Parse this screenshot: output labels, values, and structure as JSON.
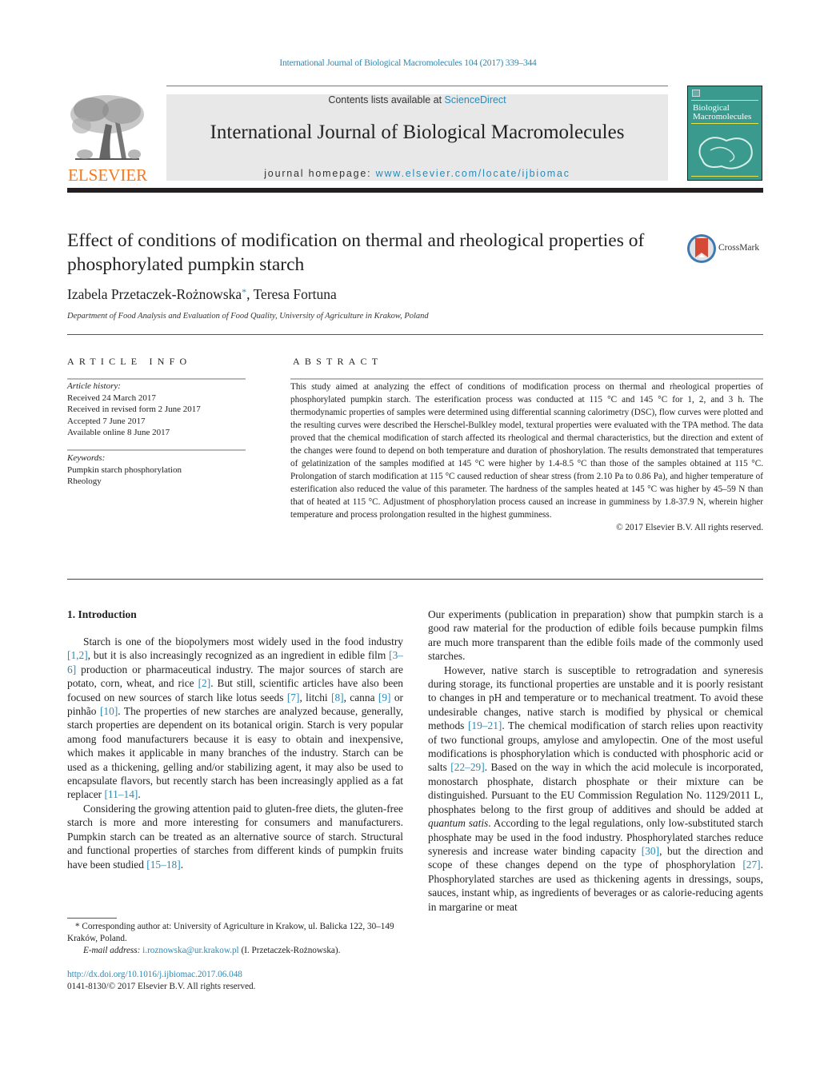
{
  "header": {
    "citation": "International Journal of Biological Macromolecules 104 (2017) 339–344",
    "publisher_logo": "ELSEVIER",
    "contents_prefix": "Contents lists available at ",
    "contents_link": "ScienceDirect",
    "journal_title": "International Journal of Biological Macromolecules",
    "homepage_prefix": "journal homepage: ",
    "homepage_link": "www.elsevier.com/locate/ijbiomac",
    "cover_title_line1": "Biological",
    "cover_title_line2": "Macromolecules",
    "crossmark_label": "CrossMark"
  },
  "article": {
    "title": "Effect of conditions of modification on thermal and rheological properties of phosphorylated pumpkin starch",
    "author1": "Izabela Przetaczek-Rożnowska",
    "author1_mark": "*",
    "author_sep": ", ",
    "author2": "Teresa Fortuna",
    "affiliation": "Department of Food Analysis and Evaluation of Food Quality, University of Agriculture in Krakow, Poland"
  },
  "article_info": {
    "heading": "ARTICLE INFO",
    "history_label": "Article history:",
    "history": [
      "Received 24 March 2017",
      "Received in revised form 2 June 2017",
      "Accepted 7 June 2017",
      "Available online 8 June 2017"
    ],
    "keywords_label": "Keywords:",
    "keywords": [
      "Pumpkin starch phosphorylation",
      "Rheology"
    ]
  },
  "abstract": {
    "heading": "ABSTRACT",
    "text": "This study aimed at analyzing the effect of conditions of modification process on thermal and rheological properties of phosphorylated pumpkin starch. The esterification process was conducted at 115 °C and 145 °C for 1, 2, and 3 h. The thermodynamic properties of samples were determined using differential scanning calorimetry (DSC), flow curves were plotted and the resulting curves were described the Herschel-Bulkley model, textural properties were evaluated with the TPA method. The data proved that the chemical modification of starch affected its rheological and thermal characteristics, but the direction and extent of the changes were found to depend on both temperature and duration of phoshorylation. The results demonstrated that temperatures of gelatinization of the samples modified at 145 °C were higher by 1.4-8.5 °C than those of the samples obtained at 115 °C. Prolongation of starch modification at 115 °C caused reduction of shear stress (from 2.10 Pa to 0.86 Pa), and higher temperature of esterification also reduced the value of this parameter. The hardness of the samples heated at 145 °C was higher by 45–59 N than that of heated at 115 °C. Adjustment of phosphorylation process caused an increase in gumminess by 1.8-37.9 N, wherein higher temperature and process prolongation resulted in the highest gumminess.",
    "copyright": "© 2017 Elsevier B.V. All rights reserved."
  },
  "intro": {
    "heading": "1.  Introduction",
    "p1": [
      {
        "t": "Starch is one of the biopolymers most widely used in the food industry "
      },
      {
        "ref": "[1,2]"
      },
      {
        "t": ", but it is also increasingly recognized as an ingredient in edible film "
      },
      {
        "ref": "[3–6]"
      },
      {
        "t": " production or pharmaceutical industry. The major sources of starch are potato, corn, wheat, and rice "
      },
      {
        "ref": "[2]"
      },
      {
        "t": ". But still, scientific articles have also been focused on new sources of starch like lotus seeds "
      },
      {
        "ref": "[7]"
      },
      {
        "t": ", litchi "
      },
      {
        "ref": "[8]"
      },
      {
        "t": ", canna "
      },
      {
        "ref": "[9]"
      },
      {
        "t": " or pinhão "
      },
      {
        "ref": "[10]"
      },
      {
        "t": ". The properties of new starches are analyzed because, generally, starch properties are dependent on its botanical origin. Starch is very popular among food manufacturers because it is easy to obtain and inexpensive, which makes it applicable in many branches of the industry. Starch can be used as a thickening, gelling and/or stabilizing agent, it may also be used to encapsulate flavors, but recently starch has been increasingly applied as a fat replacer "
      },
      {
        "ref": "[11–14]"
      },
      {
        "t": "."
      }
    ],
    "p2": [
      {
        "t": "Considering the growing attention paid to gluten-free diets, the gluten-free starch is more and more interesting for consumers and manufacturers. Pumpkin starch can be treated as an alternative source of starch. Structural and functional properties of starches from different kinds of pumpkin fruits have been studied "
      },
      {
        "ref": "[15–18]"
      },
      {
        "t": "."
      }
    ],
    "p3": [
      {
        "t": "Our experiments (publication in preparation) show that pumpkin starch is a good raw material for the production of edible foils because pumpkin films are much more transparent than the edible foils made of the commonly used starches."
      }
    ],
    "p4": [
      {
        "t": "However, native starch is susceptible to retrogradation and syneresis during storage, its functional properties are unstable and it is poorly resistant to changes in pH and temperature or to mechanical treatment. To avoid these undesirable changes, native starch is modified by physical or chemical methods "
      },
      {
        "ref": "[19–21]"
      },
      {
        "t": ". The chemical modification of starch relies upon reactivity of two functional groups, amylose and amylopectin. One of the most useful modifications is phosphorylation which is conducted with phosphoric acid or salts "
      },
      {
        "ref": "[22–29]"
      },
      {
        "t": ". Based on the way in which the acid molecule is incorporated, monostarch phosphate, distarch phosphate or their mixture can be distinguished. Pursuant to the EU Commission Regulation No. 1129/2011 L, phosphates belong to the first group of additives and should be added at "
      },
      {
        "i": "quantum satis"
      },
      {
        "t": ". According to the legal regulations, only low-substituted starch phosphate may be used in the food industry. Phosphorylated starches reduce syneresis and increase water binding capacity "
      },
      {
        "ref": "[30]"
      },
      {
        "t": ", but the direction and scope of these changes depend on the type of phosphorylation "
      },
      {
        "ref": "[27]"
      },
      {
        "t": ". Phosphorylated starches are used as thickening agents in dressings, soups, sauces, instant whip, as ingredients of beverages or as calorie-reducing agents in margarine or meat"
      }
    ]
  },
  "footnote": {
    "mark": "*",
    "text": " Corresponding author at: University of Agriculture in Krakow, ul. Balicka 122, 30–149 Kraków, Poland.",
    "email_label": "E-mail address: ",
    "email": "i.roznowska@ur.krakow.pl",
    "email_suffix": " (I. Przetaczek-Rożnowska)."
  },
  "doi": {
    "link": "http://dx.doi.org/10.1016/j.ijbiomac.2017.06.048",
    "issn_line": "0141-8130/© 2017 Elsevier B.V. All rights reserved."
  },
  "colors": {
    "link": "#2a8ab8",
    "elsevier_orange": "#f47920",
    "banner_gray": "#e8e8e8",
    "rule_dark": "#231f20",
    "cover_teal": "#3a9a8e"
  }
}
